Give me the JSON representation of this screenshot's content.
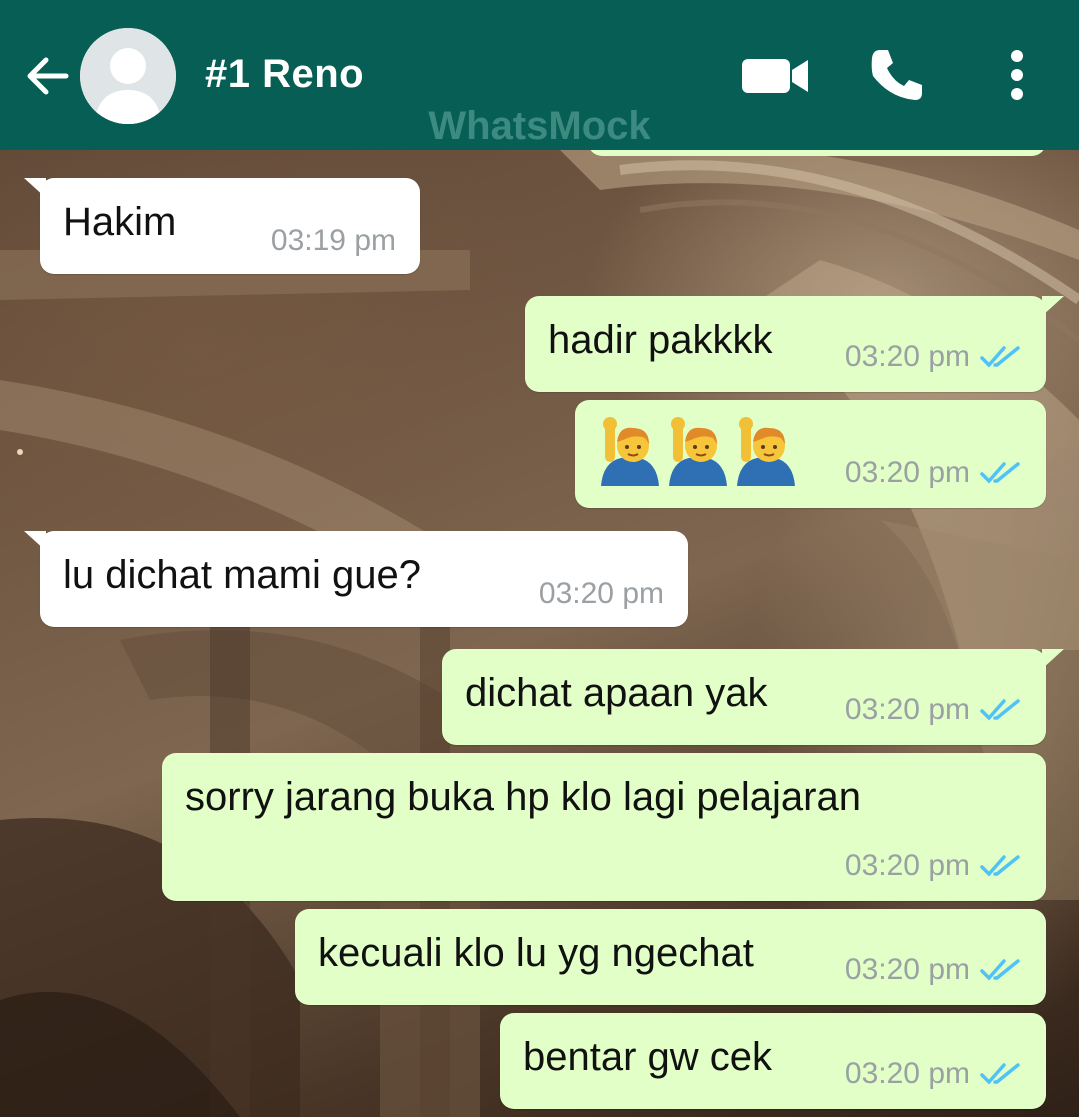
{
  "app": {
    "watermark": "WhatsMock"
  },
  "header": {
    "contact_name": "#1 Reno",
    "icons": [
      "back-arrow-icon",
      "avatar-placeholder-icon",
      "video-call-icon",
      "phone-call-icon",
      "more-options-icon"
    ],
    "colors": {
      "bar": "#075e54",
      "watermark": "#3d8a80"
    }
  },
  "messages": [
    {
      "direction": "incoming",
      "text": "Hakim",
      "time": "03:19 pm"
    },
    {
      "direction": "outgoing",
      "text": "hadir pakkkk",
      "time": "03:20 pm",
      "status": "read"
    },
    {
      "direction": "outgoing",
      "emoji": [
        "man-raising-hand",
        "man-raising-hand",
        "man-raising-hand"
      ],
      "time": "03:20 pm",
      "status": "read"
    },
    {
      "direction": "incoming",
      "text": "lu dichat mami gue?",
      "time": "03:20 pm"
    },
    {
      "direction": "outgoing",
      "text": "dichat apaan yak",
      "time": "03:20 pm",
      "status": "read"
    },
    {
      "direction": "outgoing",
      "text": "sorry jarang buka hp klo lagi pelajaran",
      "time": "03:20 pm",
      "status": "read"
    },
    {
      "direction": "outgoing",
      "text": "kecuali klo lu yg ngechat",
      "time": "03:20 pm",
      "status": "read"
    },
    {
      "direction": "outgoing",
      "text": "bentar gw cek",
      "time": "03:20 pm",
      "status": "read"
    }
  ],
  "colors": {
    "incoming_bubble": "#ffffff",
    "outgoing_bubble": "#e1ffc7",
    "read_ticks": "#4fc3f7",
    "timestamp": "#9aa0a3"
  }
}
